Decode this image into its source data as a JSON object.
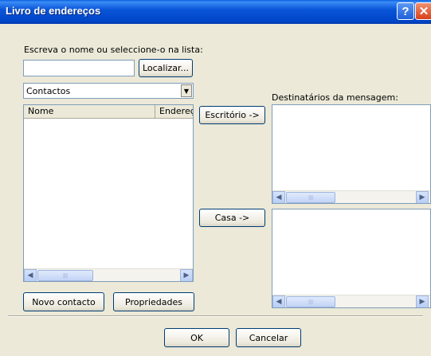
{
  "window": {
    "title": "Livro de endereços",
    "help_label": "?",
    "close_label": "✕"
  },
  "search": {
    "prompt": "Escreva o nome ou seleccione-o na lista:",
    "value": "",
    "find_button": "Localizar..."
  },
  "source": {
    "selected": "Contactos",
    "arrow": "▼"
  },
  "contacts_list": {
    "columns": [
      "Nome",
      "Endereç"
    ],
    "rows": []
  },
  "actions": {
    "office_button": "Escritório ->",
    "home_button": "Casa ->"
  },
  "recipients": {
    "label": "Destinatários da mensagem:"
  },
  "scrollbar": {
    "left_arrow": "◀",
    "right_arrow": "▶",
    "thumb_grip": "|||"
  },
  "bottom_buttons": {
    "new_contact": "Novo contacto",
    "properties": "Propriedades"
  },
  "footer": {
    "ok": "OK",
    "cancel": "Cancelar"
  }
}
